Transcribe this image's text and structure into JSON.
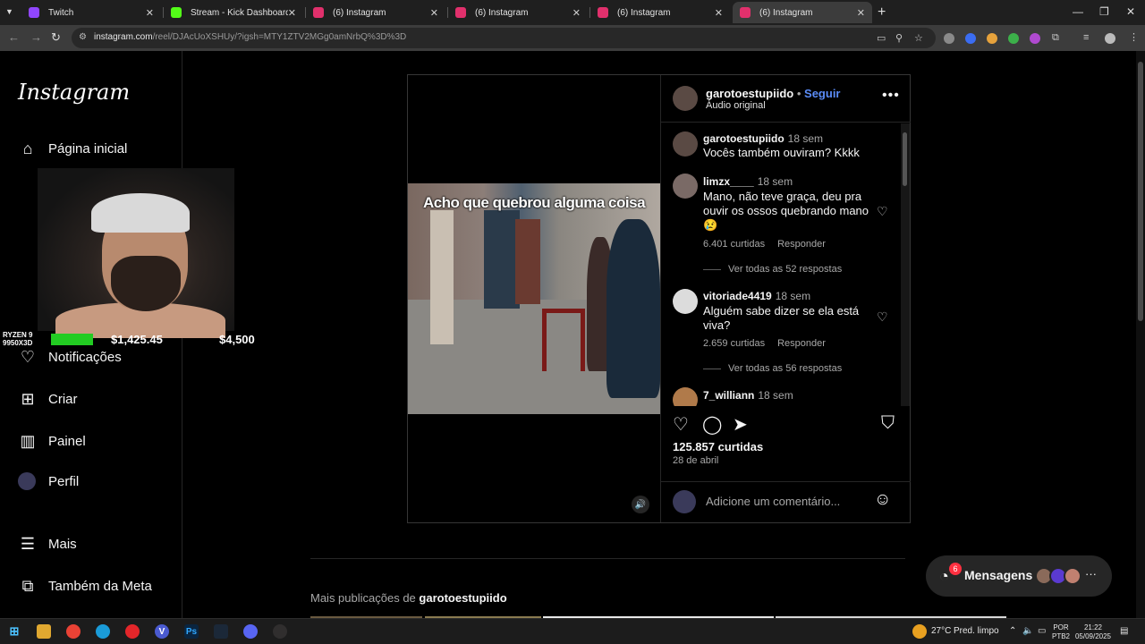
{
  "browser": {
    "tabs": [
      {
        "title": "Twitch",
        "color": "#9146ff"
      },
      {
        "title": "Stream - Kick Dashboard",
        "color": "#53fc18"
      },
      {
        "title": "(6) Instagram",
        "color": "#e1306c"
      },
      {
        "title": "(6) Instagram",
        "color": "#e1306c"
      },
      {
        "title": "(6) Instagram",
        "color": "#e1306c"
      },
      {
        "title": "(6) Instagram",
        "color": "#e1306c"
      }
    ],
    "url_host": "instagram.com",
    "url_path": "/reel/DJAcUoXSHUy/?igsh=MTY1ZTV2MGg0amNrbQ%3D%3D"
  },
  "sidebar": {
    "logo": "Instagram",
    "items": [
      {
        "label": "Página inicial",
        "icon": "home-icon"
      },
      {
        "label": "Notificações",
        "icon": "heart-icon"
      },
      {
        "label": "Criar",
        "icon": "plus-square-icon"
      },
      {
        "label": "Painel",
        "icon": "chart-icon"
      },
      {
        "label": "Perfil",
        "icon": "avatar"
      },
      {
        "label": "Mais",
        "icon": "menu-icon"
      },
      {
        "label": "Também da Meta",
        "icon": "meta-icon"
      }
    ]
  },
  "overlay": {
    "cpu_label_1": "RYZEN 9",
    "cpu_label_2": "9950X3D",
    "amount_1": "$1,425.45",
    "amount_2": "$4,500",
    "bar_color": "#22cc22"
  },
  "post": {
    "video_caption": "Acho que quebrou alguma coisa",
    "author": "garotoestupiido",
    "separator": "•",
    "follow": "Seguir",
    "audio": "Áudio original",
    "comments": [
      {
        "user": "garotoestupiido",
        "when": "18 sem",
        "text": "Vocês também ouviram? Kkkk"
      },
      {
        "user": "limzx____",
        "when": "18 sem",
        "text": "Mano, não teve graça, deu pra ouvir os ossos quebrando mano 😢",
        "likes": "6.401 curtidas",
        "reply": "Responder",
        "view_replies": "Ver todas as 52 respostas"
      },
      {
        "user": "vitoriade4419",
        "when": "18 sem",
        "text": "Alguém sabe dizer se ela está viva?",
        "likes": "2.659 curtidas",
        "reply": "Responder",
        "view_replies": "Ver todas as 56 respostas"
      },
      {
        "user": "7_williann",
        "when": "18 sem"
      }
    ],
    "likes_total": "125.857 curtidas",
    "date": "28 de abril",
    "add_comment_placeholder": "Adicione um comentário..."
  },
  "more_posts": {
    "prefix": "Mais publicações de",
    "author": "garotoestupiido"
  },
  "messages": {
    "label": "Mensagens",
    "badge": "6"
  },
  "taskbar": {
    "weather": "27°C",
    "weather_desc": "Pred. limpo",
    "lang_1": "POR",
    "lang_2": "PTB2",
    "time": "21:22",
    "date": "05/09/2025"
  }
}
